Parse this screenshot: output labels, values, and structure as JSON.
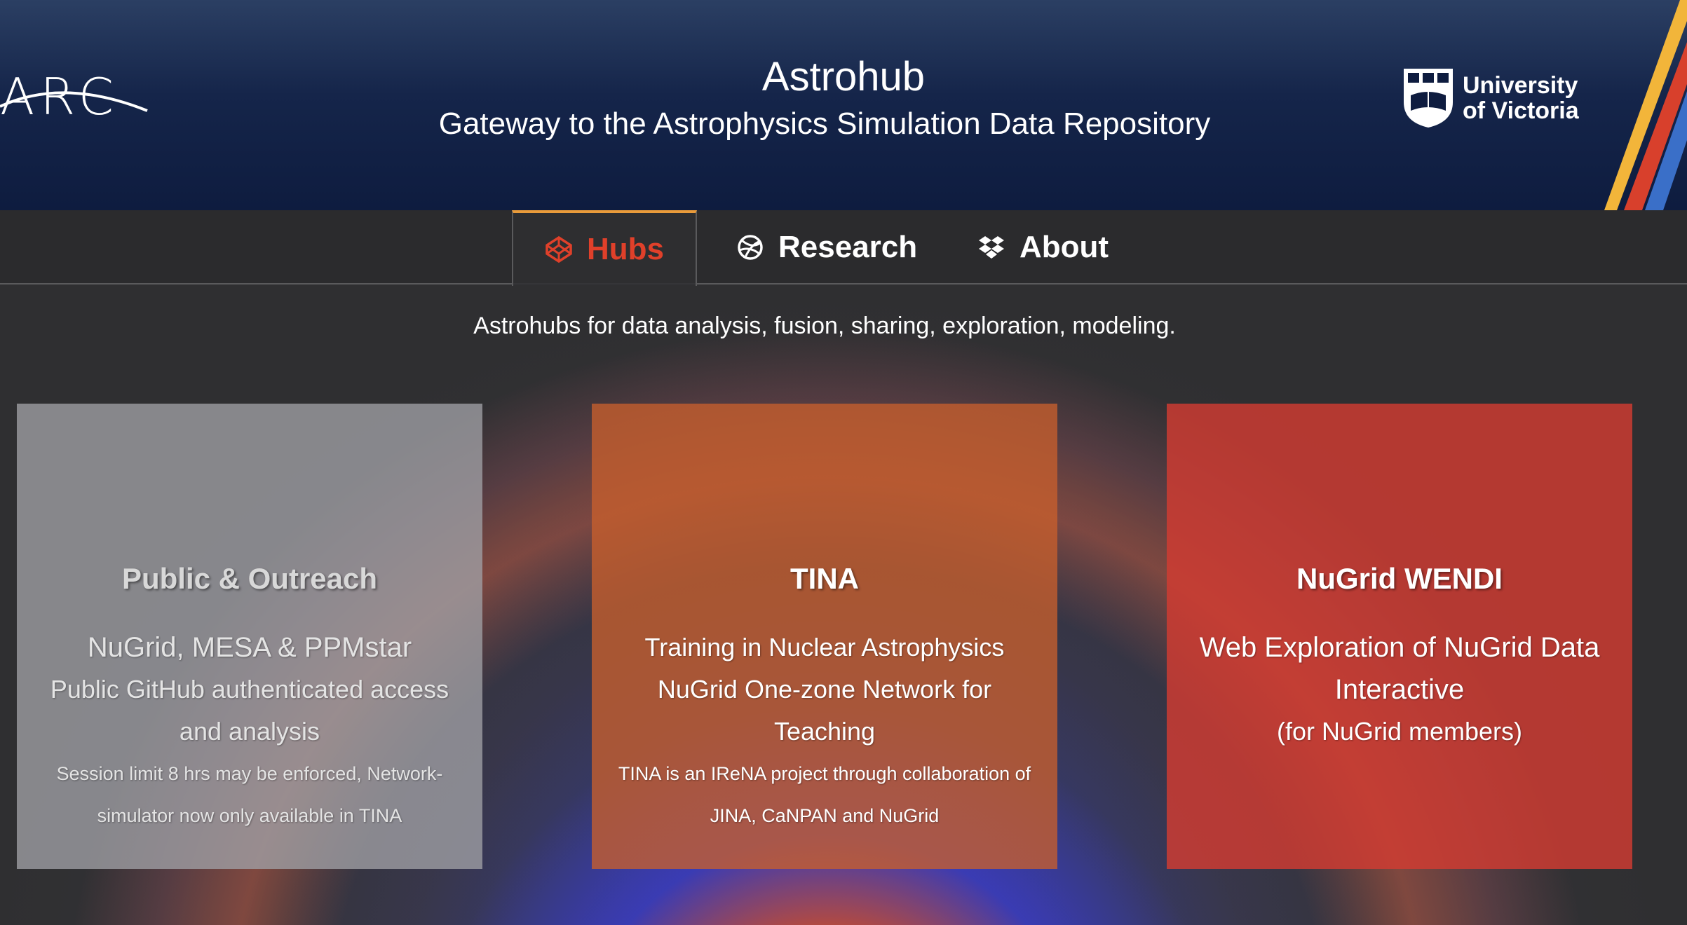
{
  "header": {
    "arc_logo_text": "ARC",
    "title": "Astrohub",
    "subtitle": "Gateway to the Astrophysics Simulation Data Repository",
    "university_line1": "University",
    "university_line2": "of Victoria"
  },
  "nav": {
    "tabs": [
      {
        "label": "Hubs",
        "icon": "codepen-icon",
        "active": true
      },
      {
        "label": "Research",
        "icon": "dribbble-icon",
        "active": false
      },
      {
        "label": "About",
        "icon": "dropbox-icon",
        "active": false
      }
    ]
  },
  "tagline": "Astrohubs for data analysis, fusion, sharing, exploration, modeling.",
  "cards": [
    {
      "title": "Public & Outreach",
      "lines": [
        "NuGrid, MESA & PPMstar",
        "Public GitHub authenticated access and analysis",
        "Session limit 8 hrs may be enforced, Network-simulator now only available in TINA"
      ]
    },
    {
      "title": "TINA",
      "lines": [
        "Training in Nuclear Astrophysics NuGrid One-zone Network for Teaching",
        "TINA is an IReNA project through collaboration of JINA, CaNPAN and NuGrid"
      ]
    },
    {
      "title": "NuGrid WENDI",
      "lines": [
        "Web Exploration of NuGrid Data Interactive",
        "(for NuGrid members)"
      ]
    }
  ],
  "colors": {
    "header_bg": "#0e1c3f",
    "active_tab_text": "#e0402a",
    "active_tab_border": "#e99b3a",
    "card_public": "#a0a0a5",
    "card_tina": "#c85f2d",
    "card_wendi": "#d23c32"
  }
}
